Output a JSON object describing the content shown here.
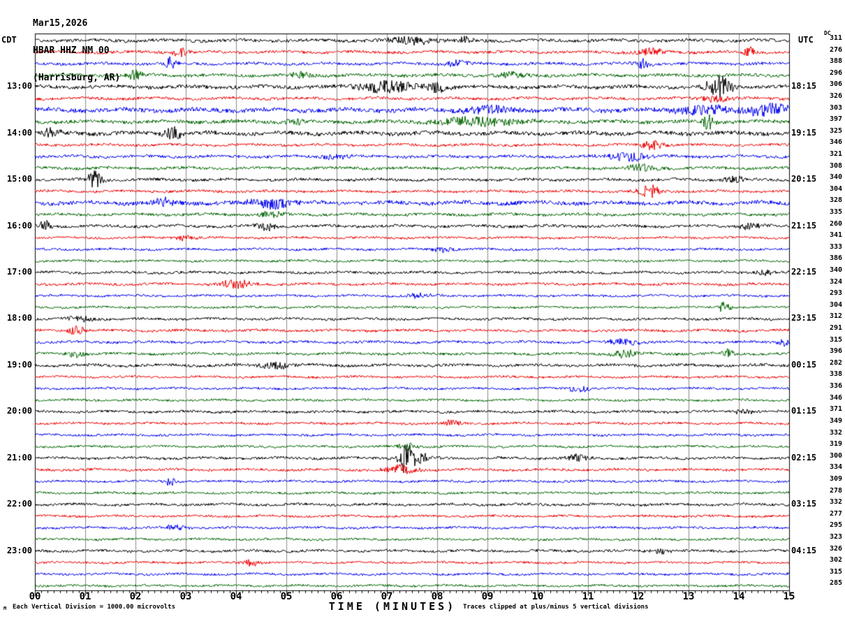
{
  "title": {
    "date": "Mar15,2026",
    "station": "HBAR HHZ NM 00",
    "location": "(Harrisburg, AR)"
  },
  "axis": {
    "left_timezone": "CDT",
    "right_timezone": "UTC",
    "dc_header": "DC",
    "x_title": "TIME (MINUTES)",
    "x_ticks": [
      "00",
      "01",
      "02",
      "03",
      "04",
      "05",
      "06",
      "07",
      "08",
      "09",
      "10",
      "11",
      "12",
      "13",
      "14",
      "15"
    ]
  },
  "footer": {
    "watermark": "M",
    "left": "Each Vertical Division = 1000.00 microvolts",
    "right": "Traces clipped at plus/minus 5 vertical divisions"
  },
  "colors": {
    "trace_cycle": [
      "#000000",
      "#ee0000",
      "#0000ee",
      "#006600"
    ],
    "grid": "#888888",
    "border": "#000000",
    "background": "#ffffff"
  },
  "chart_data": {
    "type": "line",
    "subtype": "seismogram-helicorder",
    "x_range_minutes": [
      0,
      15
    ],
    "minutes_per_line": 15,
    "rows_count": 48,
    "color_cycle_note": "traces cycle black, red, blue, green; one trace per 15-minute segment",
    "rows": [
      {
        "cdt": "",
        "utc": "",
        "dc": "311",
        "amp": 2.2,
        "events": [
          [
            7.5,
            5,
            0.4
          ],
          [
            8.6,
            4,
            0.2
          ]
        ]
      },
      {
        "cdt": "",
        "utc": "",
        "dc": "276",
        "amp": 2.0,
        "events": [
          [
            2.9,
            6,
            0.15
          ],
          [
            12.2,
            4,
            0.3
          ],
          [
            14.2,
            7,
            0.1
          ]
        ]
      },
      {
        "cdt": "",
        "utc": "",
        "dc": "388",
        "amp": 2.0,
        "events": [
          [
            2.7,
            9,
            0.1
          ],
          [
            8.4,
            4,
            0.2
          ],
          [
            12.1,
            6,
            0.15
          ]
        ]
      },
      {
        "cdt": "",
        "utc": "",
        "dc": "296",
        "amp": 2.2,
        "events": [
          [
            2.0,
            8,
            0.12
          ],
          [
            5.3,
            4,
            0.2
          ],
          [
            9.5,
            3,
            0.3
          ]
        ]
      },
      {
        "cdt": "13:00",
        "utc": "18:15",
        "dc": "306",
        "amp": 2.5,
        "events": [
          [
            7.0,
            8,
            0.5
          ],
          [
            8.0,
            6,
            0.2
          ],
          [
            13.6,
            14,
            0.25
          ]
        ]
      },
      {
        "cdt": "",
        "utc": "",
        "dc": "326",
        "amp": 2.0,
        "events": [
          [
            13.5,
            4,
            0.3
          ]
        ]
      },
      {
        "cdt": "",
        "utc": "",
        "dc": "303",
        "amp": 3.0,
        "events": [
          [
            9.0,
            4,
            0.5
          ],
          [
            13.3,
            6,
            0.5
          ],
          [
            14.6,
            8,
            0.4
          ]
        ]
      },
      {
        "cdt": "",
        "utc": "",
        "dc": "397",
        "amp": 2.5,
        "events": [
          [
            5.2,
            4,
            0.2
          ],
          [
            8.8,
            5,
            0.8
          ],
          [
            13.4,
            12,
            0.1
          ]
        ]
      },
      {
        "cdt": "14:00",
        "utc": "19:15",
        "dc": "325",
        "amp": 2.8,
        "events": [
          [
            0.3,
            5,
            0.2
          ],
          [
            2.75,
            12,
            0.15
          ]
        ]
      },
      {
        "cdt": "",
        "utc": "",
        "dc": "346",
        "amp": 1.8,
        "events": [
          [
            12.3,
            7,
            0.2
          ]
        ]
      },
      {
        "cdt": "",
        "utc": "",
        "dc": "321",
        "amp": 2.0,
        "events": [
          [
            6.0,
            3,
            0.3
          ],
          [
            11.8,
            5,
            0.4
          ]
        ]
      },
      {
        "cdt": "",
        "utc": "",
        "dc": "308",
        "amp": 2.0,
        "events": [
          [
            12.1,
            4,
            0.3
          ]
        ]
      },
      {
        "cdt": "15:00",
        "utc": "20:15",
        "dc": "340",
        "amp": 2.0,
        "events": [
          [
            1.2,
            11,
            0.15
          ],
          [
            13.9,
            4,
            0.2
          ]
        ]
      },
      {
        "cdt": "",
        "utc": "",
        "dc": "304",
        "amp": 1.8,
        "events": [
          [
            12.2,
            10,
            0.2
          ]
        ]
      },
      {
        "cdt": "",
        "utc": "",
        "dc": "328",
        "amp": 2.8,
        "events": [
          [
            2.6,
            5,
            0.2
          ],
          [
            4.7,
            6,
            0.4
          ]
        ]
      },
      {
        "cdt": "",
        "utc": "",
        "dc": "335",
        "amp": 2.0,
        "events": [
          [
            4.7,
            4,
            0.2
          ]
        ]
      },
      {
        "cdt": "16:00",
        "utc": "21:15",
        "dc": "260",
        "amp": 2.0,
        "events": [
          [
            0.2,
            8,
            0.1
          ],
          [
            4.6,
            7,
            0.15
          ],
          [
            14.2,
            4,
            0.2
          ]
        ]
      },
      {
        "cdt": "",
        "utc": "",
        "dc": "341",
        "amp": 1.6,
        "events": [
          [
            3.0,
            3,
            0.2
          ]
        ]
      },
      {
        "cdt": "",
        "utc": "",
        "dc": "333",
        "amp": 1.6,
        "events": [
          [
            8.1,
            3,
            0.2
          ]
        ]
      },
      {
        "cdt": "",
        "utc": "",
        "dc": "386",
        "amp": 1.6,
        "events": []
      },
      {
        "cdt": "17:00",
        "utc": "22:15",
        "dc": "340",
        "amp": 1.8,
        "events": [
          [
            14.5,
            3,
            0.2
          ]
        ]
      },
      {
        "cdt": "",
        "utc": "",
        "dc": "324",
        "amp": 1.8,
        "events": [
          [
            4.0,
            6,
            0.3
          ]
        ]
      },
      {
        "cdt": "",
        "utc": "",
        "dc": "293",
        "amp": 1.6,
        "events": [
          [
            7.6,
            3,
            0.2
          ]
        ]
      },
      {
        "cdt": "",
        "utc": "",
        "dc": "304",
        "amp": 1.6,
        "events": [
          [
            13.7,
            7,
            0.12
          ]
        ]
      },
      {
        "cdt": "18:00",
        "utc": "23:15",
        "dc": "312",
        "amp": 1.8,
        "events": [
          [
            0.9,
            4,
            0.2
          ]
        ]
      },
      {
        "cdt": "",
        "utc": "",
        "dc": "291",
        "amp": 1.8,
        "events": [
          [
            0.85,
            6,
            0.15
          ]
        ]
      },
      {
        "cdt": "",
        "utc": "",
        "dc": "315",
        "amp": 1.8,
        "events": [
          [
            11.7,
            4,
            0.3
          ],
          [
            14.9,
            4,
            0.1
          ]
        ]
      },
      {
        "cdt": "",
        "utc": "",
        "dc": "396",
        "amp": 1.8,
        "events": [
          [
            0.8,
            4,
            0.15
          ],
          [
            11.7,
            5,
            0.25
          ],
          [
            13.8,
            6,
            0.1
          ]
        ]
      },
      {
        "cdt": "19:00",
        "utc": "00:15",
        "dc": "282",
        "amp": 2.0,
        "events": [
          [
            4.8,
            4,
            0.3
          ]
        ]
      },
      {
        "cdt": "",
        "utc": "",
        "dc": "338",
        "amp": 1.6,
        "events": []
      },
      {
        "cdt": "",
        "utc": "",
        "dc": "336",
        "amp": 1.6,
        "events": [
          [
            10.8,
            4,
            0.2
          ]
        ]
      },
      {
        "cdt": "",
        "utc": "",
        "dc": "346",
        "amp": 1.6,
        "events": []
      },
      {
        "cdt": "20:00",
        "utc": "01:15",
        "dc": "371",
        "amp": 1.8,
        "events": [
          [
            14.1,
            3,
            0.2
          ]
        ]
      },
      {
        "cdt": "",
        "utc": "",
        "dc": "349",
        "amp": 1.6,
        "events": [
          [
            8.3,
            4,
            0.15
          ]
        ]
      },
      {
        "cdt": "",
        "utc": "",
        "dc": "332",
        "amp": 1.6,
        "events": []
      },
      {
        "cdt": "",
        "utc": "",
        "dc": "319",
        "amp": 1.6,
        "events": [
          [
            7.4,
            5,
            0.15
          ]
        ]
      },
      {
        "cdt": "21:00",
        "utc": "02:15",
        "dc": "300",
        "amp": 1.8,
        "events": [
          [
            7.4,
            26,
            0.12
          ],
          [
            7.6,
            7,
            0.3
          ],
          [
            10.8,
            4,
            0.2
          ]
        ]
      },
      {
        "cdt": "",
        "utc": "",
        "dc": "334",
        "amp": 1.8,
        "events": [
          [
            7.3,
            6,
            0.3
          ]
        ]
      },
      {
        "cdt": "",
        "utc": "",
        "dc": "309",
        "amp": 1.6,
        "events": [
          [
            2.7,
            6,
            0.1
          ]
        ]
      },
      {
        "cdt": "",
        "utc": "",
        "dc": "278",
        "amp": 1.6,
        "events": []
      },
      {
        "cdt": "22:00",
        "utc": "03:15",
        "dc": "332",
        "amp": 1.8,
        "events": []
      },
      {
        "cdt": "",
        "utc": "",
        "dc": "277",
        "amp": 1.6,
        "events": []
      },
      {
        "cdt": "",
        "utc": "",
        "dc": "295",
        "amp": 1.6,
        "events": [
          [
            2.8,
            3,
            0.2
          ]
        ]
      },
      {
        "cdt": "",
        "utc": "",
        "dc": "323",
        "amp": 1.6,
        "events": []
      },
      {
        "cdt": "23:00",
        "utc": "04:15",
        "dc": "326",
        "amp": 1.8,
        "events": [
          [
            12.4,
            3,
            0.2
          ]
        ]
      },
      {
        "cdt": "",
        "utc": "",
        "dc": "302",
        "amp": 1.6,
        "events": [
          [
            4.3,
            4,
            0.15
          ]
        ]
      },
      {
        "cdt": "",
        "utc": "",
        "dc": "315",
        "amp": 1.6,
        "events": []
      },
      {
        "cdt": "",
        "utc": "",
        "dc": "285",
        "amp": 1.6,
        "events": []
      }
    ]
  }
}
